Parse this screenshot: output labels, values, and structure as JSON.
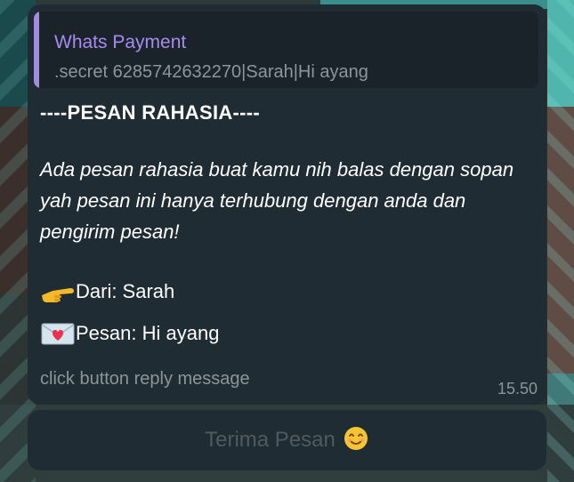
{
  "message": {
    "quote": {
      "title": "Whats Payment",
      "text": ".secret 6285742632270|Sarah|Hi ayang"
    },
    "headline": "----PESAN RAHASIA----",
    "body": "Ada pesan rahasia buat kamu nih balas dengan sopan yah pesan ini hanya terhubung dengan anda dan pengirim pesan!",
    "from_label": "Dari: Sarah",
    "message_label": "Pesan: Hi ayang",
    "from_icon": "pointing-hand-icon",
    "message_icon": "heart-letter-icon",
    "footer": "click button reply message",
    "time": "15.50"
  },
  "reply_button": {
    "label": "Terima Pesan",
    "icon": "smiling-face-icon"
  },
  "colors": {
    "bubble": "#202c33",
    "quote_accent": "#a48be0",
    "quote_title": "#a78bf0",
    "muted_text": "#8a959b",
    "button_text": "#4f5a60"
  }
}
